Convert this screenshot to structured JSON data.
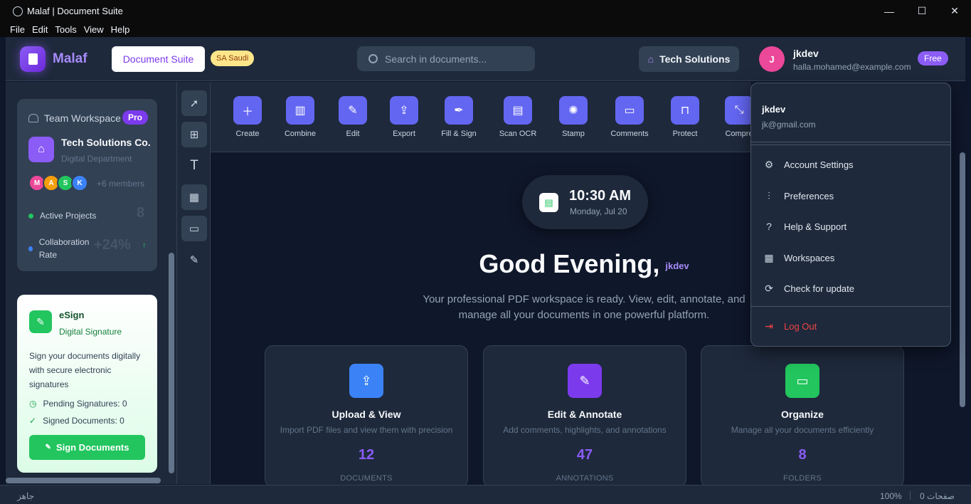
{
  "window": {
    "title": "Malaf | Document Suite",
    "minimize": "—",
    "maximize": "☐",
    "close": "✕"
  },
  "menu": [
    "File",
    "Edit",
    "Tools",
    "View",
    "Help"
  ],
  "header": {
    "brand": "Malaf",
    "suite_button": "Document Suite",
    "region_badge": "SA Saudi",
    "search_placeholder": "Search in documents...",
    "workspace_button": "Tech Solutions",
    "avatar_initial": "J",
    "user_name": "jkdev",
    "user_email": "halla.mohamed@example.com",
    "plan_badge": "Free"
  },
  "sidebar": {
    "team": {
      "title": "Team Workspace",
      "badge": "Pro",
      "company": "Tech Solutions Co.",
      "department": "Digital Department",
      "members": [
        {
          "initial": "M",
          "color": "#ec4899"
        },
        {
          "initial": "A",
          "color": "#f59e0b"
        },
        {
          "initial": "S",
          "color": "#22c55e"
        },
        {
          "initial": "K",
          "color": "#3b82f6"
        }
      ],
      "more_members": "+6 members",
      "active_projects_label": "Active Projects",
      "active_projects_value": "8",
      "collab_label": "Collaboration Rate",
      "collab_value": "+24%",
      "collab_arrow": "↑"
    },
    "esign": {
      "title": "eSign",
      "subtitle": "Digital Signature",
      "description": "Sign your documents digitally with secure electronic signatures",
      "pending": "Pending Signatures: 0",
      "signed": "Signed Documents: 0",
      "button": "Sign Documents"
    }
  },
  "toolbar_icons": [
    "cursor-icon",
    "add-file-icon",
    "text-icon",
    "grid-icon",
    "comment-icon",
    "pen-icon"
  ],
  "ribbon": [
    "Create",
    "Combine",
    "Edit",
    "Export",
    "Fill & Sign",
    "Scan OCR",
    "Stamp",
    "Comments",
    "Protect",
    "Compre"
  ],
  "clock": {
    "time": "10:30 AM",
    "date": "Monday, Jul 20"
  },
  "greeting": {
    "text": "Good Evening,",
    "user": "jkdev"
  },
  "subtitle": "Your professional PDF workspace is ready. View, edit, annotate, and manage all your documents in one powerful platform.",
  "cards": [
    {
      "title": "Upload & View",
      "desc": "Import PDF files and view them with precision",
      "count": "12",
      "label": "DOCUMENTS",
      "color": "#3b82f6",
      "icon": "upload-icon"
    },
    {
      "title": "Edit & Annotate",
      "desc": "Add comments, highlights, and annotations",
      "count": "47",
      "label": "ANNOTATIONS",
      "color": "#7c3aed",
      "icon": "edit-icon"
    },
    {
      "title": "Organize",
      "desc": "Manage all your documents efficiently",
      "count": "8",
      "label": "FOLDERS",
      "color": "#22c55e",
      "icon": "folder-icon"
    }
  ],
  "user_menu": {
    "name": "jkdev",
    "email": "jk@gmail.com",
    "items": [
      "Account Settings",
      "Preferences",
      "Help & Support",
      "Workspaces",
      "Check for update"
    ],
    "logout": "Log Out"
  },
  "status": {
    "left": "جاهز",
    "zoom": "100%",
    "pages": "صفحات 0"
  }
}
